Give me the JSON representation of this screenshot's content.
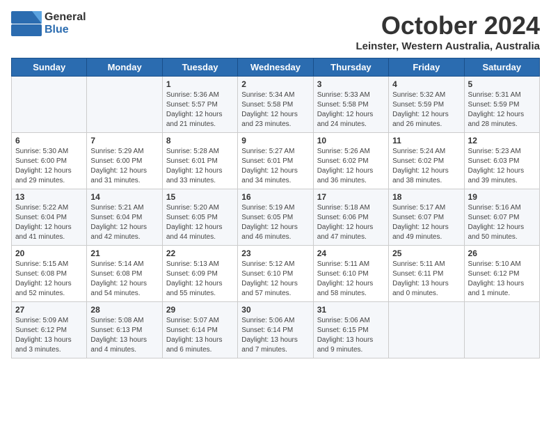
{
  "header": {
    "logo_line1": "General",
    "logo_line2": "Blue",
    "month": "October 2024",
    "location": "Leinster, Western Australia, Australia"
  },
  "days_of_week": [
    "Sunday",
    "Monday",
    "Tuesday",
    "Wednesday",
    "Thursday",
    "Friday",
    "Saturday"
  ],
  "weeks": [
    [
      {
        "day": "",
        "info": ""
      },
      {
        "day": "",
        "info": ""
      },
      {
        "day": "1",
        "info": "Sunrise: 5:36 AM\nSunset: 5:57 PM\nDaylight: 12 hours and 21 minutes."
      },
      {
        "day": "2",
        "info": "Sunrise: 5:34 AM\nSunset: 5:58 PM\nDaylight: 12 hours and 23 minutes."
      },
      {
        "day": "3",
        "info": "Sunrise: 5:33 AM\nSunset: 5:58 PM\nDaylight: 12 hours and 24 minutes."
      },
      {
        "day": "4",
        "info": "Sunrise: 5:32 AM\nSunset: 5:59 PM\nDaylight: 12 hours and 26 minutes."
      },
      {
        "day": "5",
        "info": "Sunrise: 5:31 AM\nSunset: 5:59 PM\nDaylight: 12 hours and 28 minutes."
      }
    ],
    [
      {
        "day": "6",
        "info": "Sunrise: 5:30 AM\nSunset: 6:00 PM\nDaylight: 12 hours and 29 minutes."
      },
      {
        "day": "7",
        "info": "Sunrise: 5:29 AM\nSunset: 6:00 PM\nDaylight: 12 hours and 31 minutes."
      },
      {
        "day": "8",
        "info": "Sunrise: 5:28 AM\nSunset: 6:01 PM\nDaylight: 12 hours and 33 minutes."
      },
      {
        "day": "9",
        "info": "Sunrise: 5:27 AM\nSunset: 6:01 PM\nDaylight: 12 hours and 34 minutes."
      },
      {
        "day": "10",
        "info": "Sunrise: 5:26 AM\nSunset: 6:02 PM\nDaylight: 12 hours and 36 minutes."
      },
      {
        "day": "11",
        "info": "Sunrise: 5:24 AM\nSunset: 6:02 PM\nDaylight: 12 hours and 38 minutes."
      },
      {
        "day": "12",
        "info": "Sunrise: 5:23 AM\nSunset: 6:03 PM\nDaylight: 12 hours and 39 minutes."
      }
    ],
    [
      {
        "day": "13",
        "info": "Sunrise: 5:22 AM\nSunset: 6:04 PM\nDaylight: 12 hours and 41 minutes."
      },
      {
        "day": "14",
        "info": "Sunrise: 5:21 AM\nSunset: 6:04 PM\nDaylight: 12 hours and 42 minutes."
      },
      {
        "day": "15",
        "info": "Sunrise: 5:20 AM\nSunset: 6:05 PM\nDaylight: 12 hours and 44 minutes."
      },
      {
        "day": "16",
        "info": "Sunrise: 5:19 AM\nSunset: 6:05 PM\nDaylight: 12 hours and 46 minutes."
      },
      {
        "day": "17",
        "info": "Sunrise: 5:18 AM\nSunset: 6:06 PM\nDaylight: 12 hours and 47 minutes."
      },
      {
        "day": "18",
        "info": "Sunrise: 5:17 AM\nSunset: 6:07 PM\nDaylight: 12 hours and 49 minutes."
      },
      {
        "day": "19",
        "info": "Sunrise: 5:16 AM\nSunset: 6:07 PM\nDaylight: 12 hours and 50 minutes."
      }
    ],
    [
      {
        "day": "20",
        "info": "Sunrise: 5:15 AM\nSunset: 6:08 PM\nDaylight: 12 hours and 52 minutes."
      },
      {
        "day": "21",
        "info": "Sunrise: 5:14 AM\nSunset: 6:08 PM\nDaylight: 12 hours and 54 minutes."
      },
      {
        "day": "22",
        "info": "Sunrise: 5:13 AM\nSunset: 6:09 PM\nDaylight: 12 hours and 55 minutes."
      },
      {
        "day": "23",
        "info": "Sunrise: 5:12 AM\nSunset: 6:10 PM\nDaylight: 12 hours and 57 minutes."
      },
      {
        "day": "24",
        "info": "Sunrise: 5:11 AM\nSunset: 6:10 PM\nDaylight: 12 hours and 58 minutes."
      },
      {
        "day": "25",
        "info": "Sunrise: 5:11 AM\nSunset: 6:11 PM\nDaylight: 13 hours and 0 minutes."
      },
      {
        "day": "26",
        "info": "Sunrise: 5:10 AM\nSunset: 6:12 PM\nDaylight: 13 hours and 1 minute."
      }
    ],
    [
      {
        "day": "27",
        "info": "Sunrise: 5:09 AM\nSunset: 6:12 PM\nDaylight: 13 hours and 3 minutes."
      },
      {
        "day": "28",
        "info": "Sunrise: 5:08 AM\nSunset: 6:13 PM\nDaylight: 13 hours and 4 minutes."
      },
      {
        "day": "29",
        "info": "Sunrise: 5:07 AM\nSunset: 6:14 PM\nDaylight: 13 hours and 6 minutes."
      },
      {
        "day": "30",
        "info": "Sunrise: 5:06 AM\nSunset: 6:14 PM\nDaylight: 13 hours and 7 minutes."
      },
      {
        "day": "31",
        "info": "Sunrise: 5:06 AM\nSunset: 6:15 PM\nDaylight: 13 hours and 9 minutes."
      },
      {
        "day": "",
        "info": ""
      },
      {
        "day": "",
        "info": ""
      }
    ]
  ]
}
